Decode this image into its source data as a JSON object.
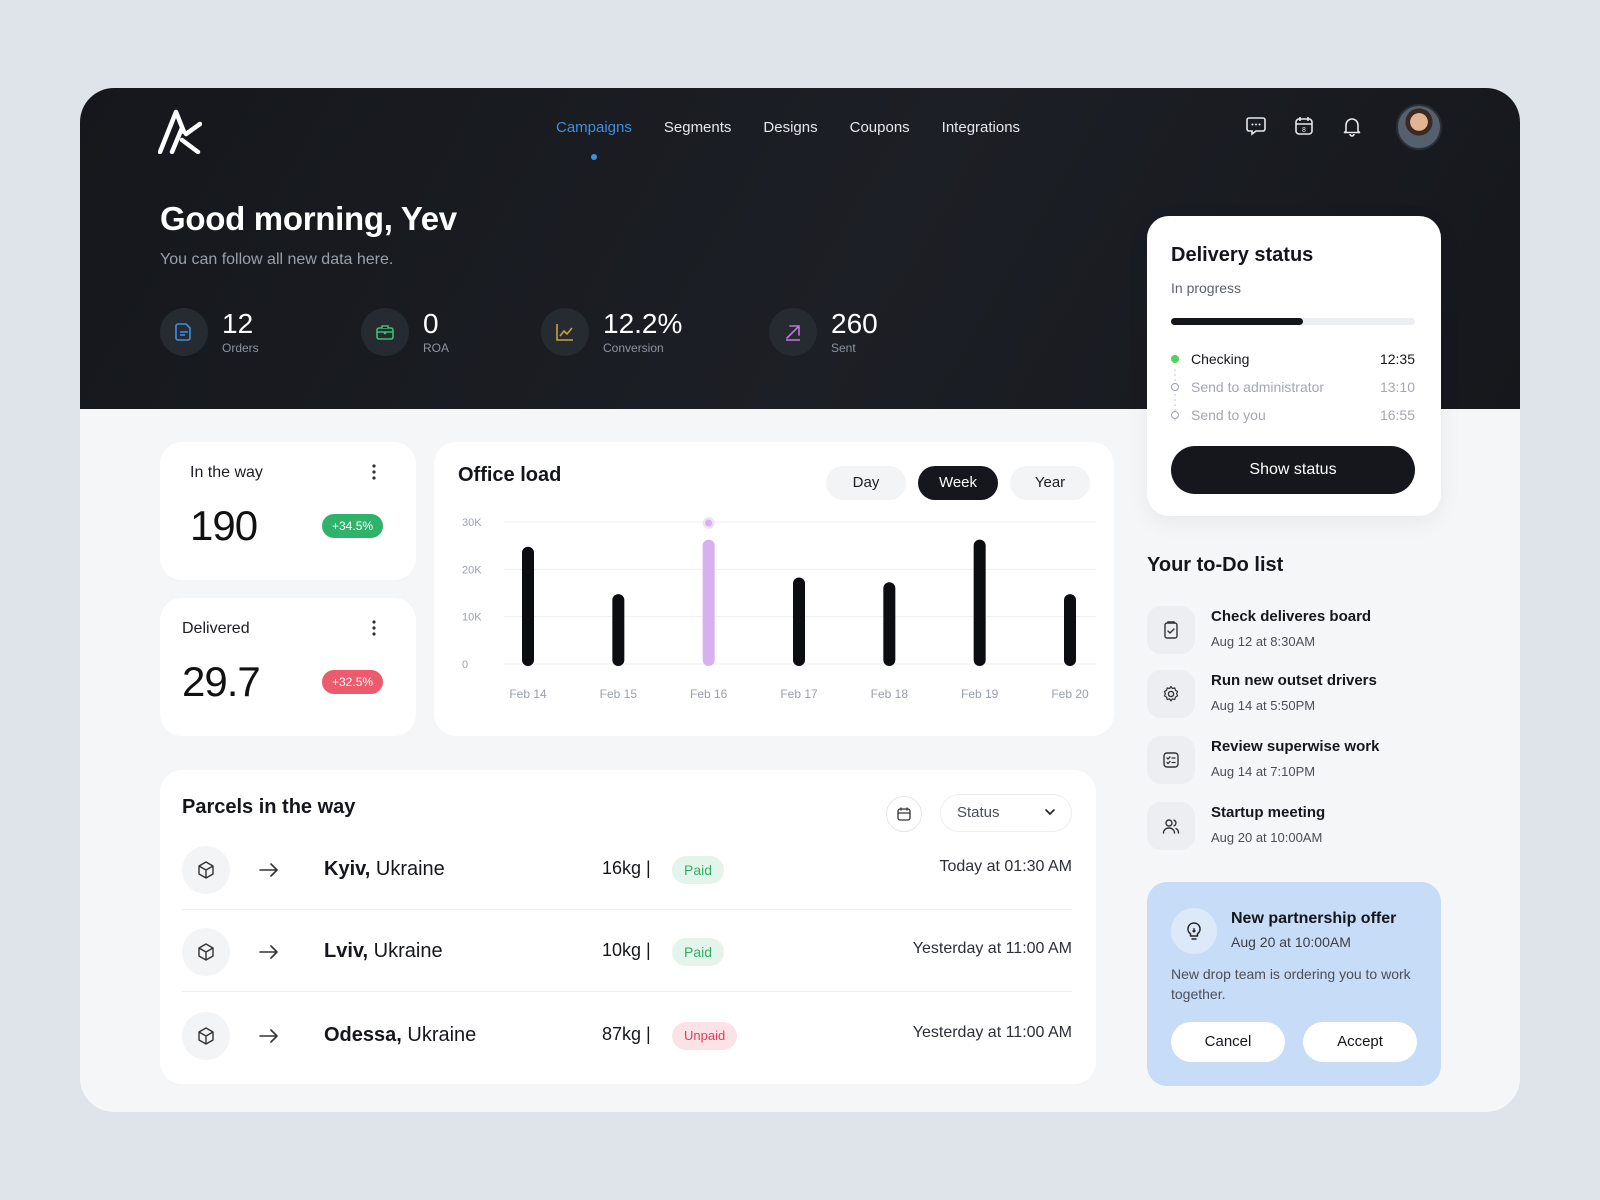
{
  "nav": {
    "items": [
      "Campaigns",
      "Segments",
      "Designs",
      "Coupons",
      "Integrations"
    ],
    "active": "Campaigns"
  },
  "header": {
    "greeting": "Good morning, Yev",
    "subtitle": "You can follow all new data here."
  },
  "stats": [
    {
      "value": "12",
      "label": "Orders",
      "icon": "document-icon",
      "color": "#3f8fe0"
    },
    {
      "value": "0",
      "label": "ROA",
      "icon": "briefcase-icon",
      "color": "#3fbf72"
    },
    {
      "value": "12.2%",
      "label": "Conversion",
      "icon": "line-chart-icon",
      "color": "#c9a23a"
    },
    {
      "value": "260",
      "label": "Sent",
      "icon": "arrow-up-right-icon",
      "color": "#c76fe0"
    }
  ],
  "kpis": {
    "in_the_way": {
      "title": "In the way",
      "value": "190",
      "badge": "+34.5%",
      "badge_color": "#2fb36a"
    },
    "delivered": {
      "title": "Delivered",
      "value": "29.7",
      "badge": "+32.5%",
      "badge_color": "#ec5a6e"
    }
  },
  "office_load": {
    "title": "Office load",
    "periods": [
      "Day",
      "Week",
      "Year"
    ],
    "active_period": "Week"
  },
  "chart_data": {
    "type": "bar",
    "categories": [
      "Feb 14",
      "Feb 15",
      "Feb 16",
      "Feb 17",
      "Feb 18",
      "Feb 19",
      "Feb 20"
    ],
    "values": [
      23500,
      13500,
      25000,
      17000,
      16000,
      25000,
      13500
    ],
    "y_ticks": [
      "30K",
      "20K",
      "10K",
      "0"
    ],
    "ylim": [
      0,
      30000
    ],
    "highlight_index": 2,
    "bar_color": "#0c0d10",
    "highlight_color": "#d7b1ef",
    "grid": true
  },
  "parcels": {
    "title": "Parcels in the way",
    "status_label": "Status",
    "rows": [
      {
        "city": "Kyiv,",
        "country": " Ukraine",
        "weight": "16kg |",
        "status": "Paid",
        "paid": true,
        "time": "Today at 01:30 AM"
      },
      {
        "city": "Lviv,",
        "country": " Ukraine",
        "weight": "10kg |",
        "status": "Paid",
        "paid": true,
        "time": "Yesterday at 11:00 AM"
      },
      {
        "city": "Odessa,",
        "country": " Ukraine",
        "weight": "87kg |",
        "status": "Unpaid",
        "paid": false,
        "time": "Yesterday at 11:00 AM"
      }
    ]
  },
  "delivery": {
    "title": "Delivery status",
    "subtitle": "In progress",
    "progress": 0.54,
    "steps": [
      {
        "name": "Checking",
        "time": "12:35",
        "done": true
      },
      {
        "name": "Send to administrator",
        "time": "13:10",
        "done": false
      },
      {
        "name": "Send to you",
        "time": "16:55",
        "done": false
      }
    ],
    "button": "Show status",
    "accent": "#4fd35a"
  },
  "todo": {
    "title": "Your to-Do list",
    "items": [
      {
        "name": "Check deliveres board",
        "date": "Aug 12 at 8:30AM",
        "icon": "clipboard-check-icon"
      },
      {
        "name": "Run new outset drivers",
        "date": "Aug 14 at 5:50PM",
        "icon": "gear-icon"
      },
      {
        "name": "Review superwise work",
        "date": "Aug 14 at 7:10PM",
        "icon": "checklist-icon"
      },
      {
        "name": "Startup meeting",
        "date": "Aug 20 at 10:00AM",
        "icon": "users-icon"
      }
    ]
  },
  "offer": {
    "title": "New partnership offer",
    "date": "Aug 20 at 10:00AM",
    "text": "New drop team is  ordering you to work together.",
    "cancel": "Cancel",
    "accept": "Accept"
  }
}
